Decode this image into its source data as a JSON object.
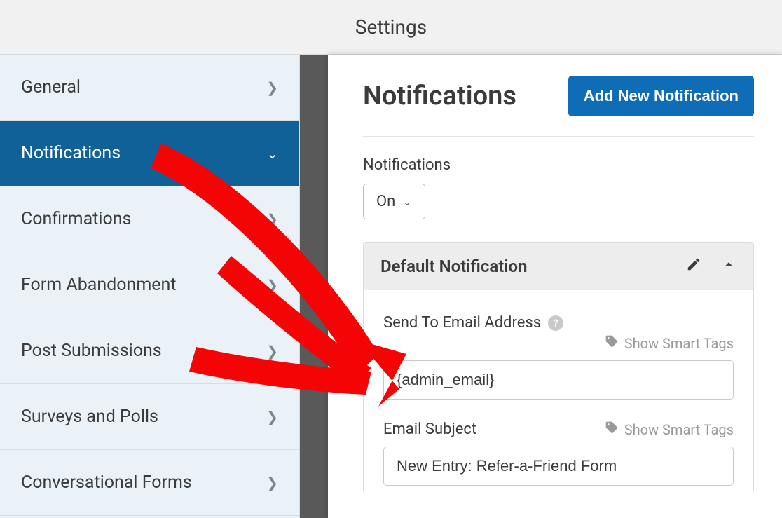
{
  "header": {
    "title": "Settings"
  },
  "sidebar": {
    "items": [
      {
        "label": "General"
      },
      {
        "label": "Notifications"
      },
      {
        "label": "Confirmations"
      },
      {
        "label": "Form Abandonment"
      },
      {
        "label": "Post Submissions"
      },
      {
        "label": "Surveys and Polls"
      },
      {
        "label": "Conversational Forms"
      }
    ]
  },
  "panel": {
    "title": "Notifications",
    "add_button": "Add New Notification",
    "toggle_label": "Notifications",
    "toggle_value": "On"
  },
  "card": {
    "title": "Default Notification",
    "send_to_label": "Send To Email Address",
    "smart_tags_label": "Show Smart Tags",
    "send_to_value": "{admin_email}",
    "subject_label": "Email Subject",
    "subject_value": "New Entry: Refer-a-Friend Form"
  }
}
